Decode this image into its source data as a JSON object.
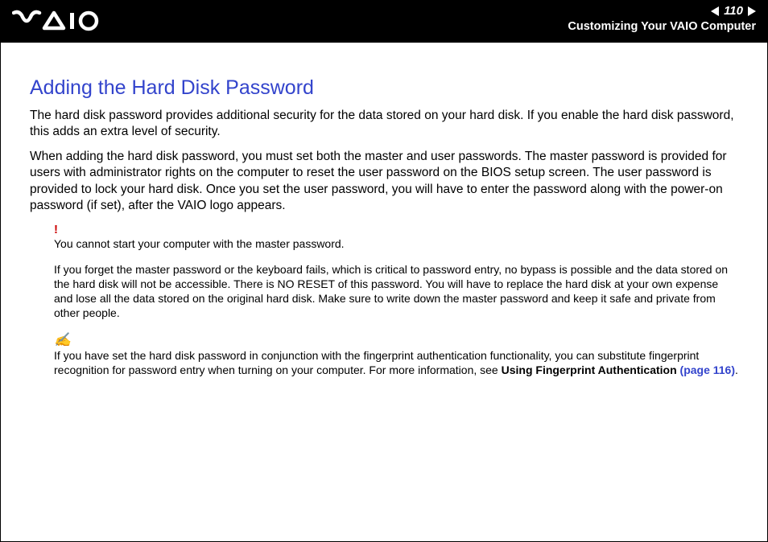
{
  "header": {
    "page_number": "110",
    "section": "Customizing Your VAIO Computer"
  },
  "content": {
    "title": "Adding the Hard Disk Password",
    "p1": "The hard disk password provides additional security for the data stored on your hard disk. If you enable the hard disk password, this adds an extra level of security.",
    "p2": "When adding the hard disk password, you must set both the master and user passwords. The master password is provided for users with administrator rights on the computer to reset the user password on the BIOS setup screen. The user password is provided to lock your hard disk. Once you set the user password, you will have to enter the password along with the power-on password (if set), after the VAIO logo appears.",
    "warn_icon": "!",
    "warn1": "You cannot start your computer with the master password.",
    "warn2": "If you forget the master password or the keyboard fails, which is critical to password entry, no bypass is possible and the data stored on the hard disk will not be accessible. There is NO RESET of this password. You will have to replace the hard disk at your own expense and lose all the data stored on the original hard disk. Make sure to write down the master password and keep it safe and private from other people.",
    "note_icon": "✍",
    "note_prefix": "If you have set the hard disk password in conjunction with the fingerprint authentication functionality, you can substitute fingerprint recognition for password entry when turning on your computer. For more information, see ",
    "note_bold": "Using Fingerprint Authentication ",
    "note_link": "(page 116)",
    "note_suffix": "."
  }
}
